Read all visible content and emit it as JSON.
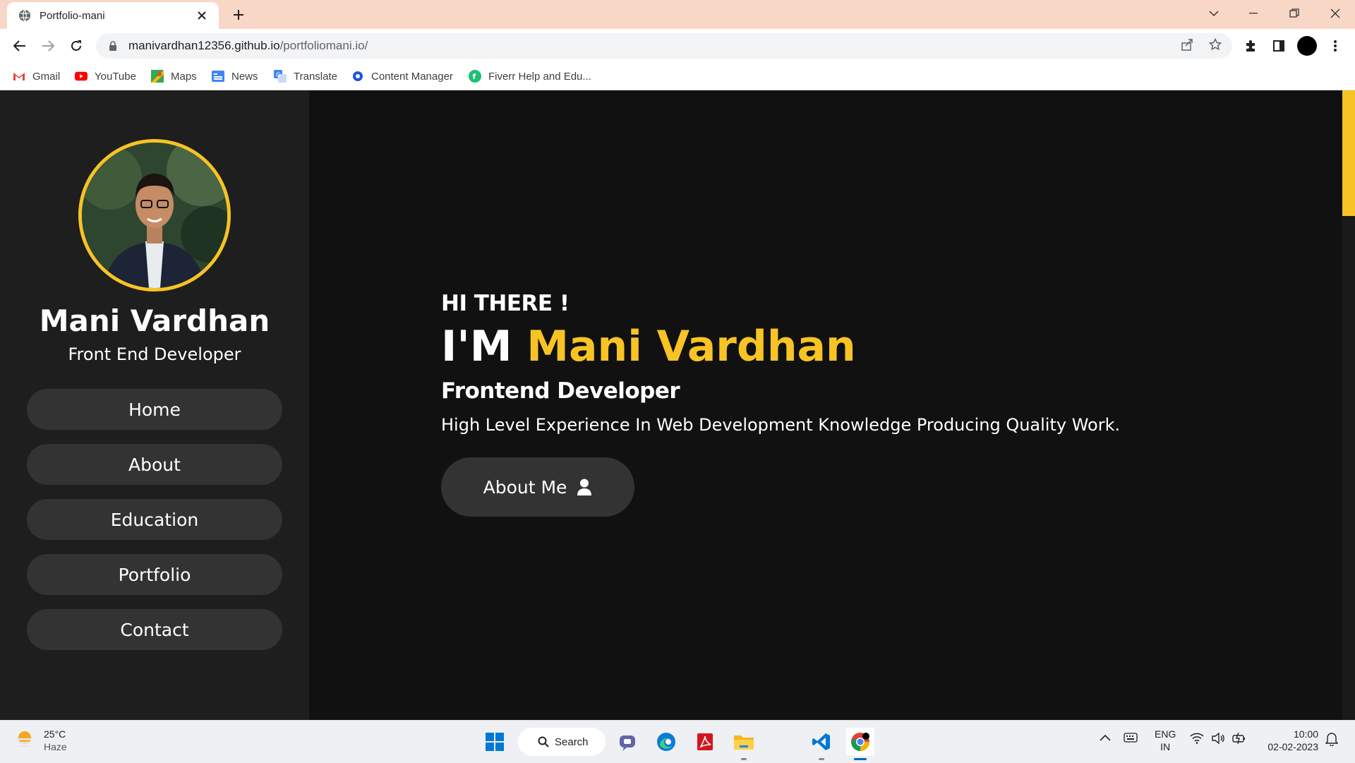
{
  "browser": {
    "tab_title": "Portfolio-mani",
    "url_domain": "manivardhan12356.github.io",
    "url_path": "/portfoliomani.io/",
    "bookmarks": [
      {
        "label": "Gmail",
        "icon": "gmail-icon"
      },
      {
        "label": "YouTube",
        "icon": "youtube-icon"
      },
      {
        "label": "Maps",
        "icon": "maps-icon"
      },
      {
        "label": "News",
        "icon": "news-icon"
      },
      {
        "label": "Translate",
        "icon": "translate-icon"
      },
      {
        "label": "Content Manager",
        "icon": "content-manager-icon"
      },
      {
        "label": "Fiverr Help and Edu...",
        "icon": "fiverr-icon"
      }
    ]
  },
  "sidebar": {
    "name": "Mani Vardhan",
    "role": "Front End Developer",
    "nav": [
      {
        "label": "Home"
      },
      {
        "label": "About"
      },
      {
        "label": "Education"
      },
      {
        "label": "Portfolio"
      },
      {
        "label": "Contact"
      }
    ]
  },
  "hero": {
    "greeting": "HI THERE !",
    "im_prefix": "I'M",
    "highlight_name": "Mani Vardhan",
    "title": "Frontend Developer",
    "description": "High Level Experience In Web Development Knowledge Producing Quality Work.",
    "button_label": "About Me"
  },
  "taskbar": {
    "weather_temp": "25°C",
    "weather_desc": "Haze",
    "search_label": "Search",
    "lang_top": "ENG",
    "lang_bottom": "IN",
    "time": "10:00",
    "date": "02-02-2023"
  },
  "colors": {
    "accent": "#f7c325",
    "page_bg": "#111111",
    "sidebar_bg": "#1e1e1e",
    "button_bg": "#333333",
    "tabstrip_bg": "#f9d7c7"
  }
}
